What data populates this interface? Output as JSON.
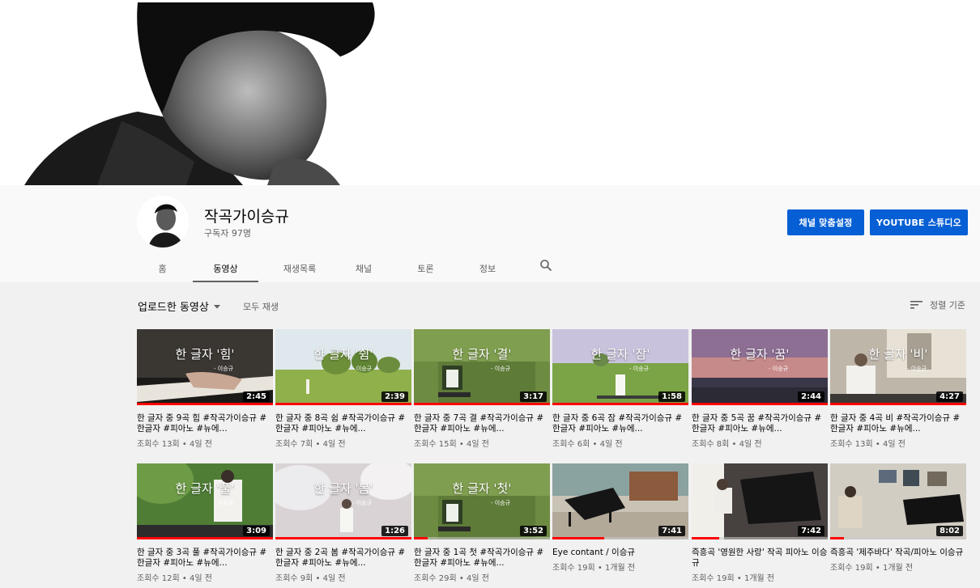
{
  "channel": {
    "name": "작곡가이승규",
    "subscribers": "구독자 97명",
    "customize_label": "채널 맞춤설정",
    "studio_label": "YOUTUBE 스튜디오"
  },
  "tabs": [
    {
      "label": "홈"
    },
    {
      "label": "동영상"
    },
    {
      "label": "재생목록"
    },
    {
      "label": "채널"
    },
    {
      "label": "토론"
    },
    {
      "label": "정보"
    }
  ],
  "filters": {
    "upload_label": "업로드한 동영상",
    "play_all": "모두 재생",
    "sort_label": "정렬 기준"
  },
  "videos": [
    {
      "title": "한 글자 중 9곡 힘 #작곡가이승규 #한글자 #피아노 #뉴에...",
      "meta": "조회수 13회 • 4일 전",
      "duration": "2:45",
      "thumb_text": "한 글자 '힘'",
      "thumb_sub": "- 이승규",
      "progress": 1.0,
      "scene": "piano"
    },
    {
      "title": "한 글자 중 8곡 쉼 #작곡가이승규 #한글자 #피아노 #뉴에...",
      "meta": "조회수 7회 • 4일 전",
      "duration": "2:39",
      "thumb_text": "한 글자 '쉼'",
      "thumb_sub": "- 이승규",
      "progress": 1.0,
      "scene": "field"
    },
    {
      "title": "한 글자 중 7곡 결 #작곡가이승규 #한글자 #피아노 #뉴에...",
      "meta": "조회수 15회 • 4일 전",
      "duration": "3:17",
      "thumb_text": "한 글자 '결'",
      "thumb_sub": "- 이승규",
      "progress": 1.0,
      "scene": "ivy"
    },
    {
      "title": "한 글자 중 6곡 잠 #작곡가이승규 #한글자 #피아노 #뉴에...",
      "meta": "조회수 6회 • 4일 전",
      "duration": "1:58",
      "thumb_text": "한 글자 '잠'",
      "thumb_sub": "- 이승규",
      "progress": 1.0,
      "scene": "meadow"
    },
    {
      "title": "한 글자 중 5곡 꿈 #작곡가이승규 #한글자 #피아노 #뉴에...",
      "meta": "조회수 8회 • 4일 전",
      "duration": "2:44",
      "thumb_text": "한 글자 '꿈'",
      "thumb_sub": "- 이승규",
      "progress": 1.0,
      "scene": "sunset"
    },
    {
      "title": "한 글자 중 4곡 비 #작곡가이승규 #한글자 #피아노 #뉴에...",
      "meta": "조회수 13회 • 4일 전",
      "duration": "4:27",
      "thumb_text": "한 글자 '비'",
      "thumb_sub": "- 이승규",
      "progress": 1.0,
      "scene": "window"
    },
    {
      "title": "한 글자 중 3곡 풀 #작곡가이승규 #한글자 #피아노 #뉴에...",
      "meta": "조회수 12회 • 4일 전",
      "duration": "3:09",
      "thumb_text": "한 글자 '풀'",
      "thumb_sub": "- 이승규",
      "progress": 1.0,
      "scene": "piano-green"
    },
    {
      "title": "한 글자 중 2곡 봄 #작곡가이승규 #한글자 #피아노 #뉴에...",
      "meta": "조회수 9회 • 4일 전",
      "duration": "1:26",
      "thumb_text": "한 글자 '봄'",
      "thumb_sub": "- 이승규",
      "progress": 1.0,
      "scene": "blossom"
    },
    {
      "title": "한 글자 중 1곡 첫 #작곡가이승규 #한글자 #피아노 #뉴에...",
      "meta": "조회수 29회 • 4일 전",
      "duration": "3:52",
      "thumb_text": "한 글자 '첫'",
      "thumb_sub": "- 이승규",
      "progress": 0.1,
      "scene": "ivy"
    },
    {
      "title": "Eye contant / 이승규",
      "meta": "조회수 19회 • 1개월 전",
      "duration": "7:41",
      "thumb_text": "",
      "thumb_sub": "",
      "progress": 0.38,
      "scene": "grand-piano"
    },
    {
      "title": "즉흥곡 '영원한 사랑' 작곡 피아노 이승규",
      "meta": "조회수 19회 • 1개월 전",
      "duration": "7:42",
      "thumb_text": "",
      "thumb_sub": "",
      "progress": 0.2,
      "scene": "piano-room"
    },
    {
      "title": "즉흥곡 '제주바다' 작곡/피아노 이승규",
      "meta": "조회수 19회 • 1개월 전",
      "duration": "8:02",
      "thumb_text": "",
      "thumb_sub": "",
      "progress": 0.1,
      "scene": "gallery"
    }
  ]
}
